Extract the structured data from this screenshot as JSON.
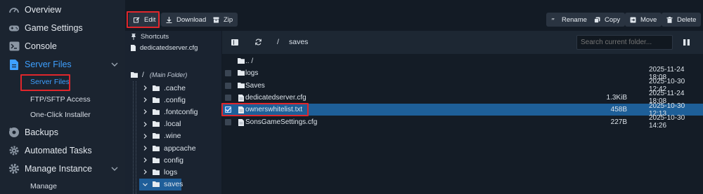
{
  "nav": {
    "items": [
      {
        "label": "Overview",
        "icon": "gauge-icon"
      },
      {
        "label": "Game Settings",
        "icon": "gamepad-icon"
      },
      {
        "label": "Console",
        "icon": "terminal-icon"
      },
      {
        "label": "Server Files",
        "icon": "file-icon"
      },
      {
        "label": "Backups",
        "icon": "backup-icon"
      },
      {
        "label": "Automated Tasks",
        "icon": "gear-icon"
      },
      {
        "label": "Manage Instance",
        "icon": "cog-icon"
      }
    ],
    "sub_server_files": [
      "Server Files",
      "FTP/SFTP Access",
      "One-Click Installer"
    ],
    "sub_manage": [
      "Manage"
    ]
  },
  "toolbar": {
    "edit": "Edit",
    "download": "Download",
    "zip": "Zip",
    "rename": "Rename",
    "copy": "Copy",
    "move": "Move",
    "delete": "Delete"
  },
  "tree": {
    "shortcuts_label": "Shortcuts",
    "shortcut_file": "dedicatedserver.cfg",
    "root_label": "/",
    "root_note": "(Main Folder)",
    "folders": [
      ".cache",
      ".config",
      ".fontconfig",
      ".local",
      ".wine",
      "appcache",
      "config",
      "logs",
      "saves"
    ]
  },
  "files": {
    "path_sep": "/",
    "path_current": "saves",
    "search_placeholder": "Search current folder...",
    "rows": [
      {
        "name": ".. /",
        "size": "",
        "date": "",
        "type": "folder",
        "checkbox": false
      },
      {
        "name": "logs",
        "size": "",
        "date": "2025-11-24 18:08",
        "type": "folder",
        "checkbox": true
      },
      {
        "name": "Saves",
        "size": "",
        "date": "2025-10-30 12:42",
        "type": "folder",
        "checkbox": true
      },
      {
        "name": "dedicatedserver.cfg",
        "size": "1.3KiB",
        "date": "2025-11-24 18:08",
        "type": "file",
        "checkbox": true
      },
      {
        "name": "ownerswhitelist.txt",
        "size": "458B",
        "date": "2025-10-30 12:13",
        "type": "file",
        "checkbox": true,
        "selected": true
      },
      {
        "name": "SonsGameSettings.cfg",
        "size": "227B",
        "date": "2025-10-30 14:26",
        "type": "file",
        "checkbox": true
      }
    ]
  },
  "colors": {
    "accent": "#3ea0ff",
    "highlight": "#e0262b",
    "selected_row": "#1e5f98"
  }
}
